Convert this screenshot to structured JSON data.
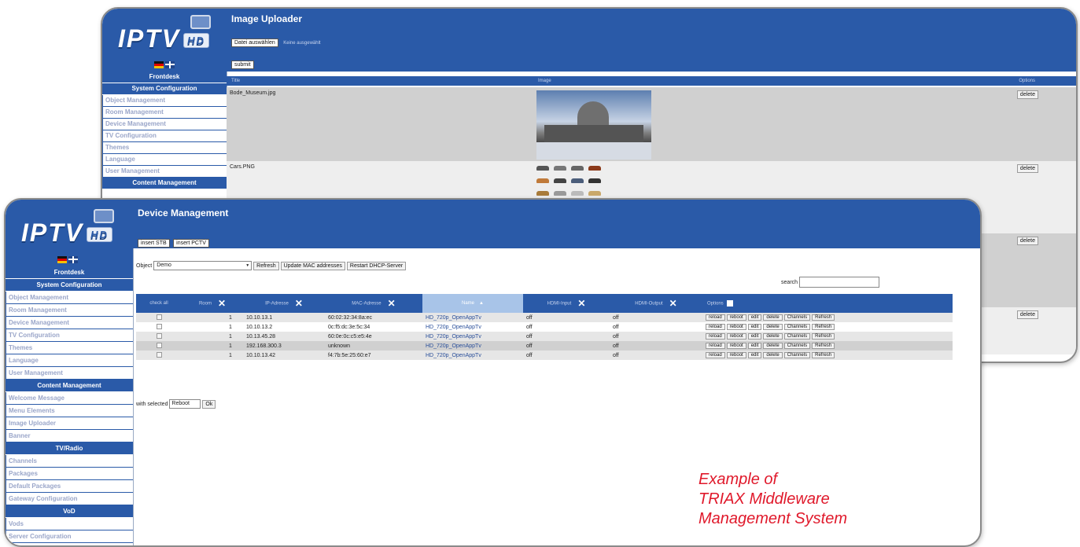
{
  "colors": {
    "primary": "#2a5aa8",
    "accent_text": "#e0192b",
    "sidebar_item_text": "#9aa6c9"
  },
  "back_window": {
    "logo": {
      "text": "IPTV",
      "badge": "HD"
    },
    "page_title": "Image Uploader",
    "choose_label": "Datei auswählen",
    "no_file_label": "Keine ausgewählt",
    "submit_label": "submit",
    "sidebar": [
      {
        "kind": "head",
        "label": "Frontdesk"
      },
      {
        "kind": "head",
        "label": "System Configuration"
      },
      {
        "kind": "item",
        "label": "Object Management"
      },
      {
        "kind": "item",
        "label": "Room Management"
      },
      {
        "kind": "item",
        "label": "Device Management"
      },
      {
        "kind": "item",
        "label": "TV Configuration"
      },
      {
        "kind": "item",
        "label": "Themes"
      },
      {
        "kind": "item",
        "label": "Language"
      },
      {
        "kind": "item",
        "label": "User Management"
      },
      {
        "kind": "head",
        "label": "Content Management"
      }
    ],
    "table_headers": [
      "Title",
      "Image",
      "Options"
    ],
    "rows": [
      {
        "title": "Bode_Museum.jpg",
        "delete": "delete"
      },
      {
        "title": "Cars.PNG",
        "delete": "delete"
      }
    ],
    "extra_delete": [
      "delete",
      "delete"
    ]
  },
  "front_window": {
    "logo": {
      "text": "IPTV",
      "badge": "HD"
    },
    "page_title": "Device Management",
    "insert_stb": "insert STB",
    "insert_pctv": "insert PCTV",
    "object_label": "Object",
    "object_value": "Demo",
    "refresh_label": "Refresh",
    "update_mac_label": "Update MAC addresses",
    "restart_dhcp_label": "Restart DHCP-Server",
    "search_label": "search",
    "sidebar": [
      {
        "kind": "head",
        "label": "Frontdesk"
      },
      {
        "kind": "head",
        "label": "System Configuration"
      },
      {
        "kind": "item",
        "label": "Object Management"
      },
      {
        "kind": "item",
        "label": "Room Management"
      },
      {
        "kind": "item",
        "label": "Device Management"
      },
      {
        "kind": "item",
        "label": "TV Configuration"
      },
      {
        "kind": "item",
        "label": "Themes"
      },
      {
        "kind": "item",
        "label": "Language"
      },
      {
        "kind": "item",
        "label": "User Management"
      },
      {
        "kind": "head",
        "label": "Content Management"
      },
      {
        "kind": "item",
        "label": "Welcome Message"
      },
      {
        "kind": "item",
        "label": "Menu Elements"
      },
      {
        "kind": "item",
        "label": "Image Uploader"
      },
      {
        "kind": "item",
        "label": "Banner"
      },
      {
        "kind": "head",
        "label": "TV/Radio"
      },
      {
        "kind": "item",
        "label": "Channels"
      },
      {
        "kind": "item",
        "label": "Packages"
      },
      {
        "kind": "item",
        "label": "Default Packages"
      },
      {
        "kind": "item",
        "label": "Gateway Configuration"
      },
      {
        "kind": "head",
        "label": "VoD"
      },
      {
        "kind": "item",
        "label": "Vods"
      },
      {
        "kind": "item",
        "label": "Server Configuration"
      }
    ],
    "columns": [
      "check all",
      "Room",
      "IP-Adresse",
      "MAC-Adresse",
      "Name",
      "HDMI-Input",
      "HDMI-Output",
      "Options"
    ],
    "rows": [
      {
        "room": "1",
        "ip": "10.10.13.1",
        "mac": "60:02:32:34:8a:ec",
        "name": "HD_720p_OpenAppTv",
        "hdmi_in": "off",
        "hdmi_out": "off"
      },
      {
        "room": "1",
        "ip": "10.10.13.2",
        "mac": "0c:f5:dc:3e:5c:34",
        "name": "HD_720p_OpenAppTv",
        "hdmi_in": "off",
        "hdmi_out": "off"
      },
      {
        "room": "1",
        "ip": "10.13.45.28",
        "mac": "60:0e:0c:c5:e5:4e",
        "name": "HD_720p_OpenAppTv",
        "hdmi_in": "off",
        "hdmi_out": "off"
      },
      {
        "room": "1",
        "ip": "192.168.300.3",
        "mac": "unknown",
        "name": "HD_720p_OpenAppTv",
        "hdmi_in": "off",
        "hdmi_out": "off"
      },
      {
        "room": "1",
        "ip": "10.10.13.42",
        "mac": "f4:7b:5e:25:60:e7",
        "name": "HD_720p_OpenAppTv",
        "hdmi_in": "off",
        "hdmi_out": "off"
      }
    ],
    "row_actions": [
      "reload",
      "reboot",
      "edit",
      "delete",
      "Channels",
      "Refresh"
    ],
    "with_selected_label": "with selected",
    "with_selected_value": "Reboot",
    "ok_label": "Ok"
  },
  "caption": [
    "Example of",
    "TRIAX Middleware",
    "Management System"
  ]
}
